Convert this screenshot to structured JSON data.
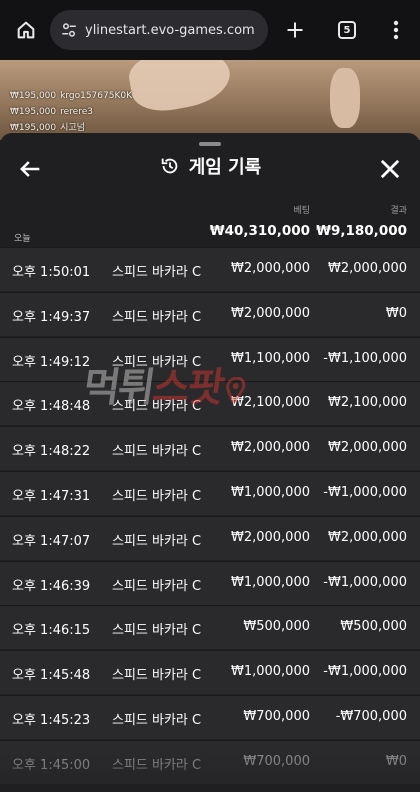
{
  "browser": {
    "url": "ylinestart.evo-games.com",
    "tab_count": "5"
  },
  "winners": [
    {
      "amount": "₩195,000",
      "name": "krgo157675K0K"
    },
    {
      "amount": "₩195,000",
      "name": "rerere3"
    },
    {
      "amount": "₩195,000",
      "name": "시고넘"
    }
  ],
  "panel": {
    "title": "게임 기록",
    "bet_header": "베팅",
    "result_header": "결과",
    "today_label": "오늘",
    "total_bet": "₩40,310,000",
    "total_result": "₩9,180,000"
  },
  "records": [
    {
      "time": "오후 1:50:01",
      "game": "스피드 바카라 C",
      "bet": "₩2,000,000",
      "result": "₩2,000,000"
    },
    {
      "time": "오후 1:49:37",
      "game": "스피드 바카라 C",
      "bet": "₩2,000,000",
      "result": "₩0"
    },
    {
      "time": "오후 1:49:12",
      "game": "스피드 바카라 C",
      "bet": "₩1,100,000",
      "result": "-₩1,100,000"
    },
    {
      "time": "오후 1:48:48",
      "game": "스피드 바카라 C",
      "bet": "₩2,100,000",
      "result": "₩2,100,000"
    },
    {
      "time": "오후 1:48:22",
      "game": "스피드 바카라 C",
      "bet": "₩2,000,000",
      "result": "₩2,000,000"
    },
    {
      "time": "오후 1:47:31",
      "game": "스피드 바카라 C",
      "bet": "₩1,000,000",
      "result": "-₩1,000,000"
    },
    {
      "time": "오후 1:47:07",
      "game": "스피드 바카라 C",
      "bet": "₩2,000,000",
      "result": "₩2,000,000"
    },
    {
      "time": "오후 1:46:39",
      "game": "스피드 바카라 C",
      "bet": "₩1,000,000",
      "result": "-₩1,000,000"
    },
    {
      "time": "오후 1:46:15",
      "game": "스피드 바카라 C",
      "bet": "₩500,000",
      "result": "₩500,000"
    },
    {
      "time": "오후 1:45:48",
      "game": "스피드 바카라 C",
      "bet": "₩1,000,000",
      "result": "-₩1,000,000"
    },
    {
      "time": "오후 1:45:23",
      "game": "스피드 바카라 C",
      "bet": "₩700,000",
      "result": "-₩700,000"
    },
    {
      "time": "오후 1:45:00",
      "game": "스피드 바카라 C",
      "bet": "₩700,000",
      "result": "₩0"
    }
  ],
  "watermark": {
    "part1": "먹튀",
    "part2": "스팟"
  },
  "icons": {
    "home": "home-icon",
    "site_settings": "tune-icon",
    "new_tab": "plus-icon",
    "tabs": "tab-switcher-icon",
    "menu": "more-vert-icon",
    "back": "arrow-left-icon",
    "history": "history-icon",
    "close": "close-icon"
  }
}
